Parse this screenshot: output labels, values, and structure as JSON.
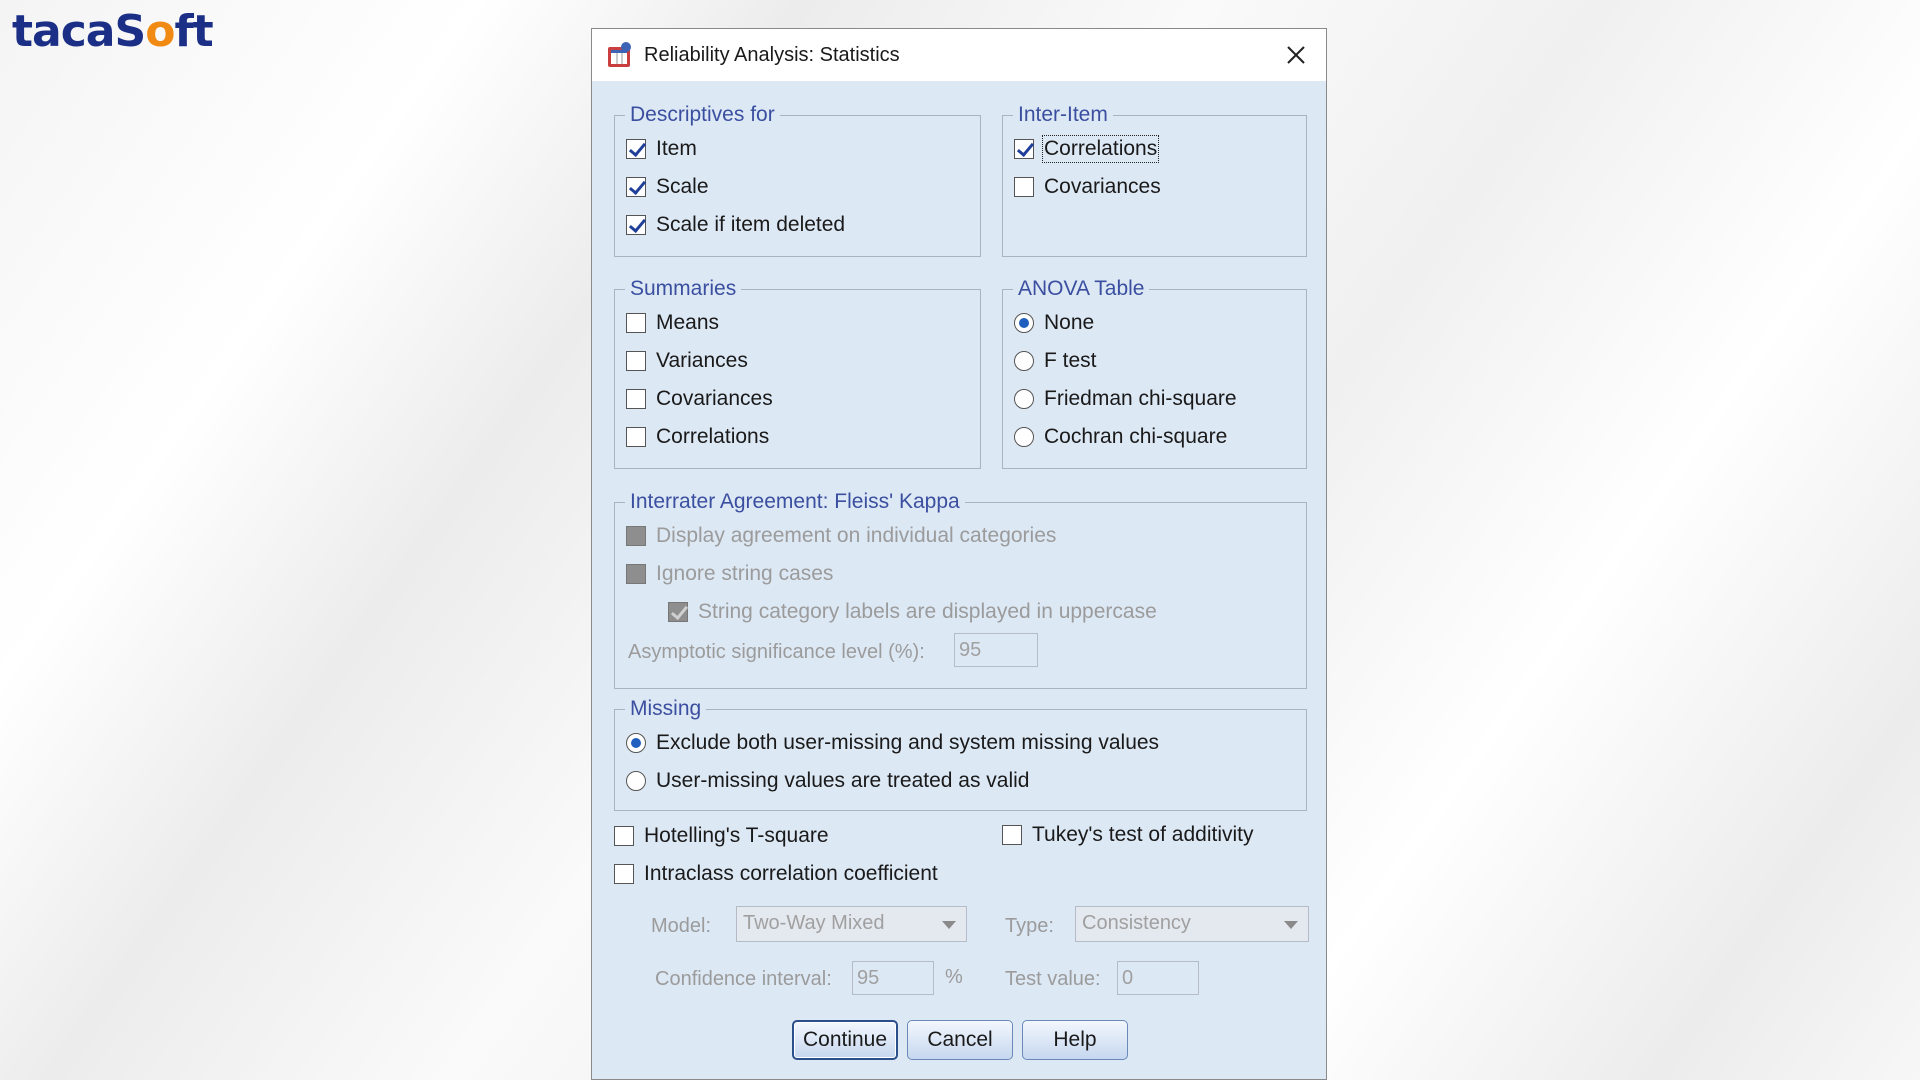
{
  "logo": {
    "prefix": "taca",
    "mid": "S",
    "o": "o",
    "suffix": "ft"
  },
  "window": {
    "title": "Reliability Analysis: Statistics",
    "icon": "spss-dialog-icon",
    "close_icon": "close-icon"
  },
  "descriptives": {
    "legend": "Descriptives for",
    "items": [
      {
        "label": "Item",
        "checked": true
      },
      {
        "label": "Scale",
        "checked": true
      },
      {
        "label": "Scale if item deleted",
        "checked": true
      }
    ]
  },
  "inter_item": {
    "legend": "Inter-Item",
    "items": [
      {
        "label": "Correlations",
        "checked": true
      },
      {
        "label": "Covariances",
        "checked": false
      }
    ]
  },
  "summaries": {
    "legend": "Summaries",
    "items": [
      {
        "label": "Means",
        "checked": false
      },
      {
        "label": "Variances",
        "checked": false
      },
      {
        "label": "Covariances",
        "checked": false
      },
      {
        "label": "Correlations",
        "checked": false
      }
    ]
  },
  "anova": {
    "legend": "ANOVA Table",
    "selected": "None",
    "options": [
      {
        "label": "None"
      },
      {
        "label": "F test"
      },
      {
        "label": "Friedman chi-square"
      },
      {
        "label": "Cochran chi-square"
      }
    ]
  },
  "kappa": {
    "legend": "Interrater Agreement: Fleiss' Kappa",
    "display_agreement": "Display agreement on individual categories",
    "ignore_string": "Ignore string cases",
    "uppercase": "String category labels are displayed in uppercase",
    "asymptotic_label": "Asymptotic significance level (%):",
    "asymptotic_value": "95"
  },
  "missing": {
    "legend": "Missing",
    "options": [
      {
        "label": "Exclude both user-missing and system missing values",
        "selected": true
      },
      {
        "label": "User-missing values are treated as valid",
        "selected": false
      }
    ]
  },
  "extra": {
    "hotelling": "Hotelling's T-square",
    "tukey": "Tukey's test of additivity",
    "intraclass": "Intraclass correlation coefficient"
  },
  "icc": {
    "model_label": "Model:",
    "model_value": "Two-Way Mixed",
    "type_label": "Type:",
    "type_value": "Consistency",
    "ci_label": "Confidence interval:",
    "ci_value": "95",
    "ci_unit": "%",
    "test_label": "Test value:",
    "test_value": "0"
  },
  "buttons": {
    "continue": "Continue",
    "cancel": "Cancel",
    "help": "Help"
  }
}
